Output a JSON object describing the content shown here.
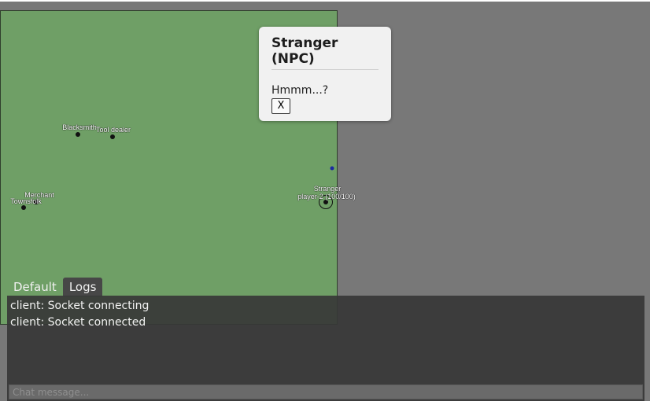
{
  "map": {
    "entities": [
      {
        "id": "blacksmith",
        "label": "Blacksmith"
      },
      {
        "id": "tool-dealer",
        "label": "Tool dealer"
      },
      {
        "id": "merchant",
        "label": "Merchant"
      },
      {
        "id": "townsfolk",
        "label": "Townsfolk"
      },
      {
        "id": "stranger",
        "label": "Stranger"
      },
      {
        "id": "player",
        "label": "player-2 (100/100)"
      }
    ]
  },
  "dialog": {
    "title": "Stranger (NPC)",
    "message": "Hmmm...?",
    "close_label": "X"
  },
  "chat": {
    "tabs": [
      {
        "label": "Default",
        "active": false
      },
      {
        "label": "Logs",
        "active": true
      }
    ],
    "log_lines": [
      "client: Socket connecting",
      "client: Socket connected"
    ],
    "input_placeholder": "Chat message..."
  },
  "colors": {
    "map_green": "#6f9f66",
    "page_gray": "#787878",
    "panel_dark": "#373737"
  }
}
